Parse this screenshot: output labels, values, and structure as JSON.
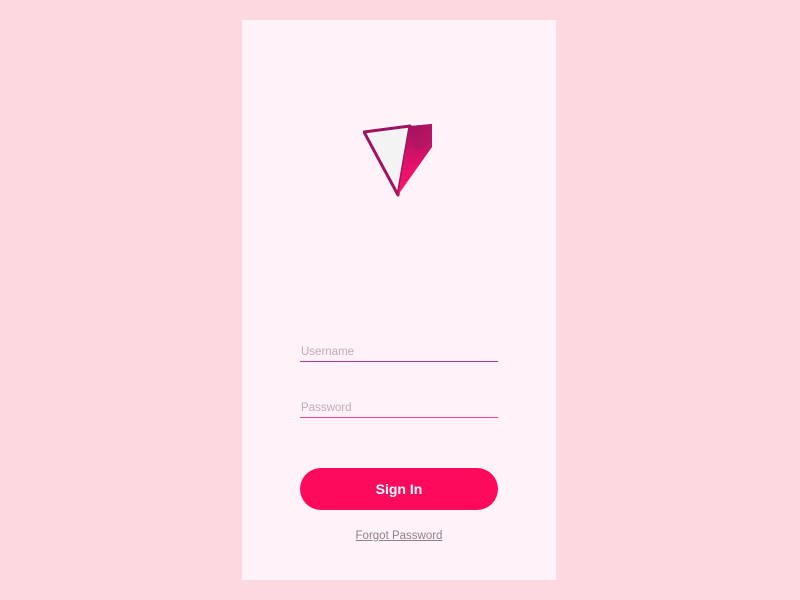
{
  "login": {
    "username": {
      "value": "",
      "placeholder": "Username"
    },
    "password": {
      "value": "",
      "placeholder": "Password"
    },
    "sign_in_label": "Sign In",
    "forgot_password_label": "Forgot Password"
  },
  "logo": {
    "icon": "triangle-logo-icon"
  },
  "colors": {
    "background": "#fdd8de",
    "card": "#fff3f9",
    "accent": "#fe0a5d",
    "logo_dark": "#a0135f",
    "logo_light": "#f3f3f3"
  }
}
